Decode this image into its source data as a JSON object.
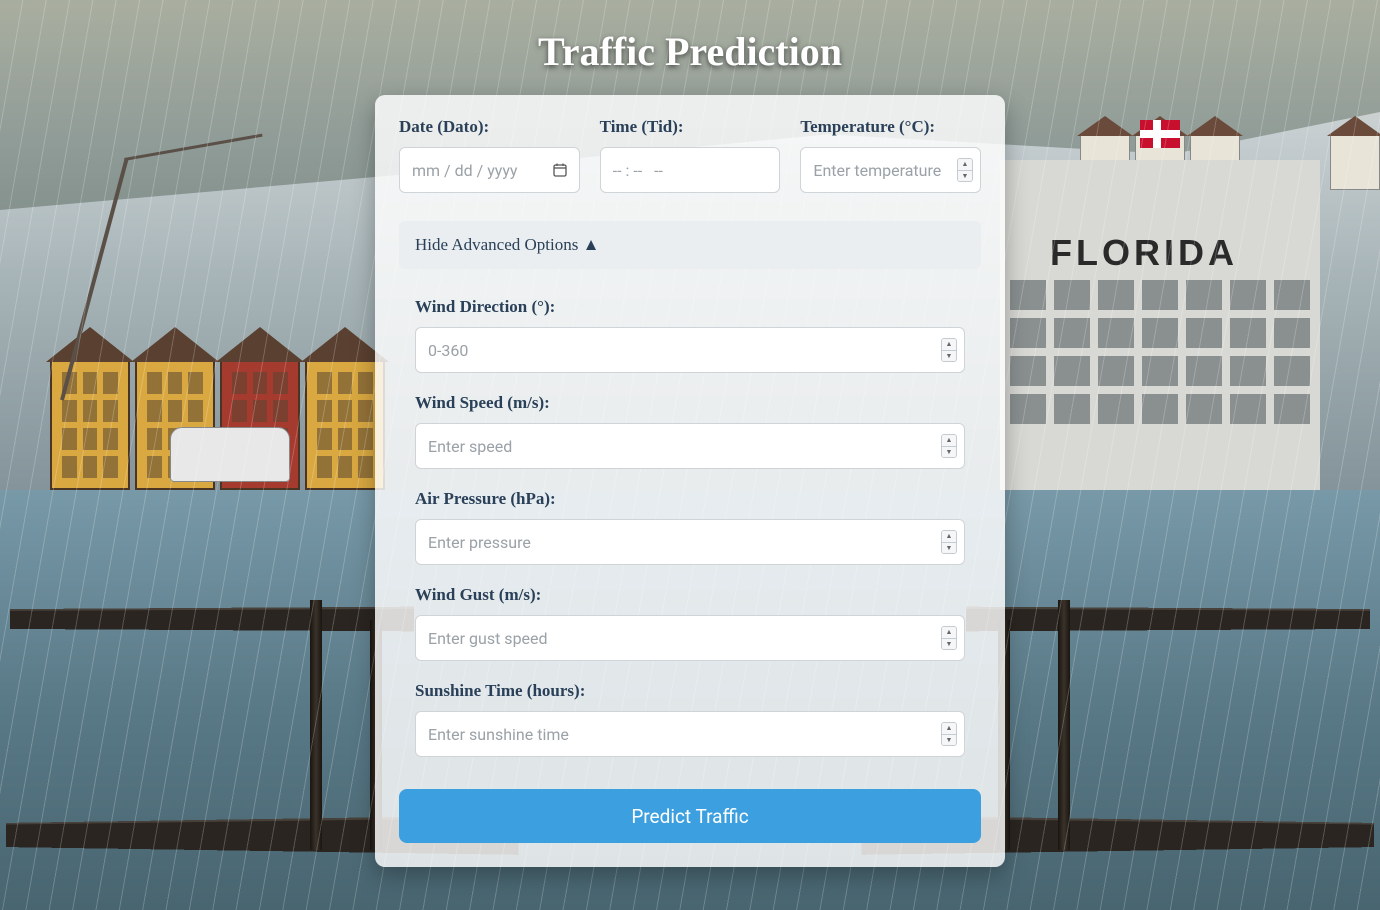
{
  "page_title": "Traffic Prediction",
  "form": {
    "date": {
      "label": "Date (Dato):",
      "placeholder": "mm / dd / yyyy",
      "value": ""
    },
    "time": {
      "label": "Time (Tid):",
      "placeholder": "-- : --   --",
      "value": ""
    },
    "temperature": {
      "label": "Temperature (°C):",
      "placeholder": "Enter temperature",
      "value": ""
    }
  },
  "advanced_toggle": {
    "label": "Hide Advanced Options",
    "arrow": "▲",
    "expanded": true
  },
  "advanced": {
    "wind_direction": {
      "label": "Wind Direction (°):",
      "placeholder": "0-360",
      "value": ""
    },
    "wind_speed": {
      "label": "Wind Speed (m/s):",
      "placeholder": "Enter speed",
      "value": ""
    },
    "air_pressure": {
      "label": "Air Pressure (hPa):",
      "placeholder": "Enter pressure",
      "value": ""
    },
    "wind_gust": {
      "label": "Wind Gust (m/s):",
      "placeholder": "Enter gust speed",
      "value": ""
    },
    "sunshine_time": {
      "label": "Sunshine Time (hours):",
      "placeholder": "Enter sunshine time",
      "value": ""
    }
  },
  "submit_button": "Predict Traffic",
  "scenery": {
    "building_sign": "FLORIDA"
  }
}
